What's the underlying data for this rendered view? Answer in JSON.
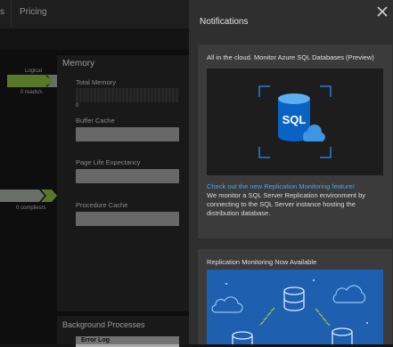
{
  "app": {
    "nav": {
      "tab_cut": "s",
      "tab_pricing": "Pricing"
    },
    "side": {
      "logical": "Logical",
      "reads": "0 reads/s",
      "compiles": "0 compiles/s"
    },
    "memory": {
      "title": "Memory",
      "total_memory": "Total Memory",
      "total_memory_value": "0",
      "buffer_cache": "Buffer Cache",
      "page_life": "Page Life Expectancy",
      "procedure_cache": "Procedure Cache"
    },
    "background": {
      "title": "Background Processes",
      "field": "Error Log"
    },
    "accent_color": "#8dc63f"
  },
  "notifications": {
    "title": "Notifications",
    "close_icon": "close-icon",
    "cards": [
      {
        "heading": "All in the cloud. Monitor Azure SQL Databases (Preview)",
        "image_label": "SQL",
        "link": "Check out the new Replication Monitoring feature!",
        "description": "We monitor a SQL Server Replication environment by connecting to the SQL Server instance hosting the distribution database."
      },
      {
        "heading": "Replication Monitoring Now Available"
      }
    ]
  }
}
